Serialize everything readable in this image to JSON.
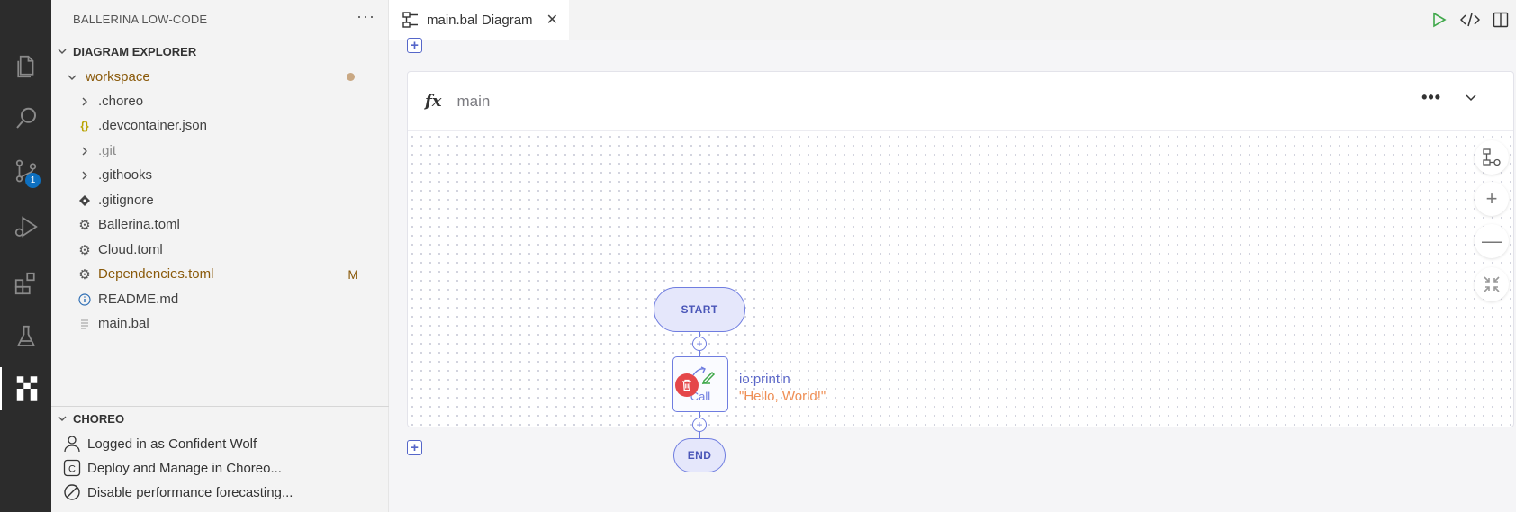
{
  "activity_bar": {
    "items": [
      {
        "icon": "files-icon"
      },
      {
        "icon": "search-icon"
      },
      {
        "icon": "source-control-icon",
        "badge": "1"
      },
      {
        "icon": "run-debug-icon"
      },
      {
        "icon": "extensions-icon"
      },
      {
        "icon": "testing-icon"
      },
      {
        "icon": "choreo-icon",
        "active": true
      }
    ]
  },
  "sidebar": {
    "title": "BALLERINA LOW-CODE",
    "explorer_header": "DIAGRAM EXPLORER",
    "tree": [
      {
        "label": "workspace",
        "type": "folder-open",
        "status": "dot"
      },
      {
        "label": ".choreo",
        "type": "folder"
      },
      {
        "label": ".devcontainer.json",
        "type": "json"
      },
      {
        "label": ".git",
        "type": "folder"
      },
      {
        "label": ".githooks",
        "type": "folder"
      },
      {
        "label": ".gitignore",
        "type": "git"
      },
      {
        "label": "Ballerina.toml",
        "type": "settings"
      },
      {
        "label": "Cloud.toml",
        "type": "settings"
      },
      {
        "label": "Dependencies.toml",
        "type": "settings",
        "status": "M"
      },
      {
        "label": "README.md",
        "type": "info"
      },
      {
        "label": "main.bal",
        "type": "text"
      }
    ],
    "choreo_header": "CHOREO",
    "choreo_items": [
      {
        "label": "Logged in as Confident Wolf",
        "icon": "user-icon"
      },
      {
        "label": "Deploy and Manage in Choreo...",
        "icon": "choreo-c-icon"
      },
      {
        "label": "Disable performance forecasting...",
        "icon": "disable-icon"
      }
    ]
  },
  "editor": {
    "tab_label": "main.bal Diagram",
    "function_badge": "fx",
    "function_name": "main",
    "more": "•••",
    "nodes": {
      "start": "START",
      "end": "END",
      "call_text": "Call",
      "call_label": "io:println",
      "call_arg": "\"Hello, World!\""
    }
  },
  "colors": {
    "accent": "#6f7de0",
    "modified": "#8a5a0b",
    "string": "#ef8f55",
    "delete": "#e5474a",
    "run": "#3fa84a"
  }
}
